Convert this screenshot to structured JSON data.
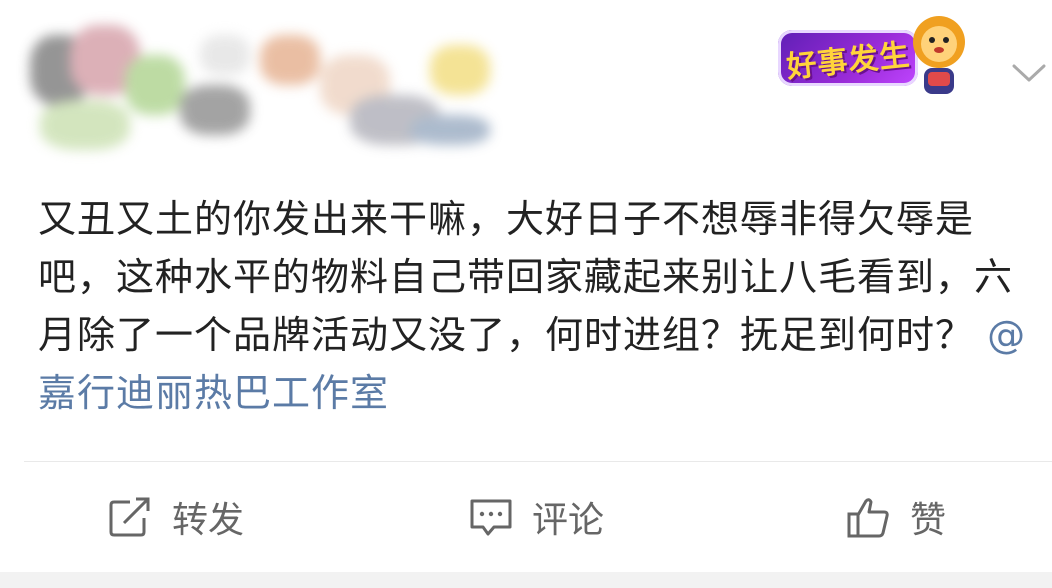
{
  "post": {
    "text_main": "又丑又土的你发出来干嘛，大好日子不想辱非得欠辱是吧，这种水平的物料自己带回家藏起来别让八毛看到，六月除了一个品牌活动又没了，何时进组？抚足到何时？",
    "mention": "@嘉行迪丽热巴工作室"
  },
  "badge": {
    "label": "好事发生",
    "icon": "lion-mascot-icon"
  },
  "header": {
    "menu_icon": "chevron-down-icon"
  },
  "actions": {
    "repost_label": "转发",
    "comment_label": "评论",
    "like_label": "赞"
  },
  "colors": {
    "text": "#222222",
    "mention": "#5b7ba6",
    "action_text": "#666666",
    "badge_purple": "#8a2be2",
    "badge_yellow": "#ffd43b"
  }
}
